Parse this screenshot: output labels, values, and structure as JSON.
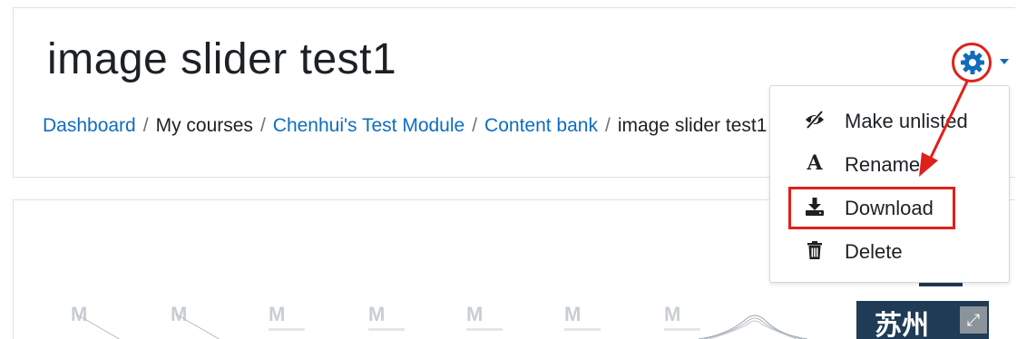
{
  "header": {
    "title": "image slider test1"
  },
  "breadcrumb": {
    "items": [
      {
        "label": "Dashboard",
        "link": true
      },
      {
        "label": "My courses",
        "link": false
      },
      {
        "label": "Chenhui's Test Module",
        "link": true
      },
      {
        "label": "Content bank",
        "link": true
      },
      {
        "label": "image slider test1",
        "link": false
      }
    ],
    "separator": "/"
  },
  "actions_menu": {
    "trigger_icon": "gear-icon",
    "items": [
      {
        "label": "Make unlisted",
        "icon": "eye-slash-icon"
      },
      {
        "label": "Rename",
        "icon": "font-icon"
      },
      {
        "label": "Download",
        "icon": "download-icon"
      },
      {
        "label": "Delete",
        "icon": "trash-icon"
      }
    ]
  },
  "slider": {
    "thumbnail_mark": "M",
    "city_label": "苏州",
    "expand_icon": "expand-icon"
  },
  "colors": {
    "link": "#0f6cbf",
    "annotation": "#e0201a",
    "text": "#1d2125"
  }
}
